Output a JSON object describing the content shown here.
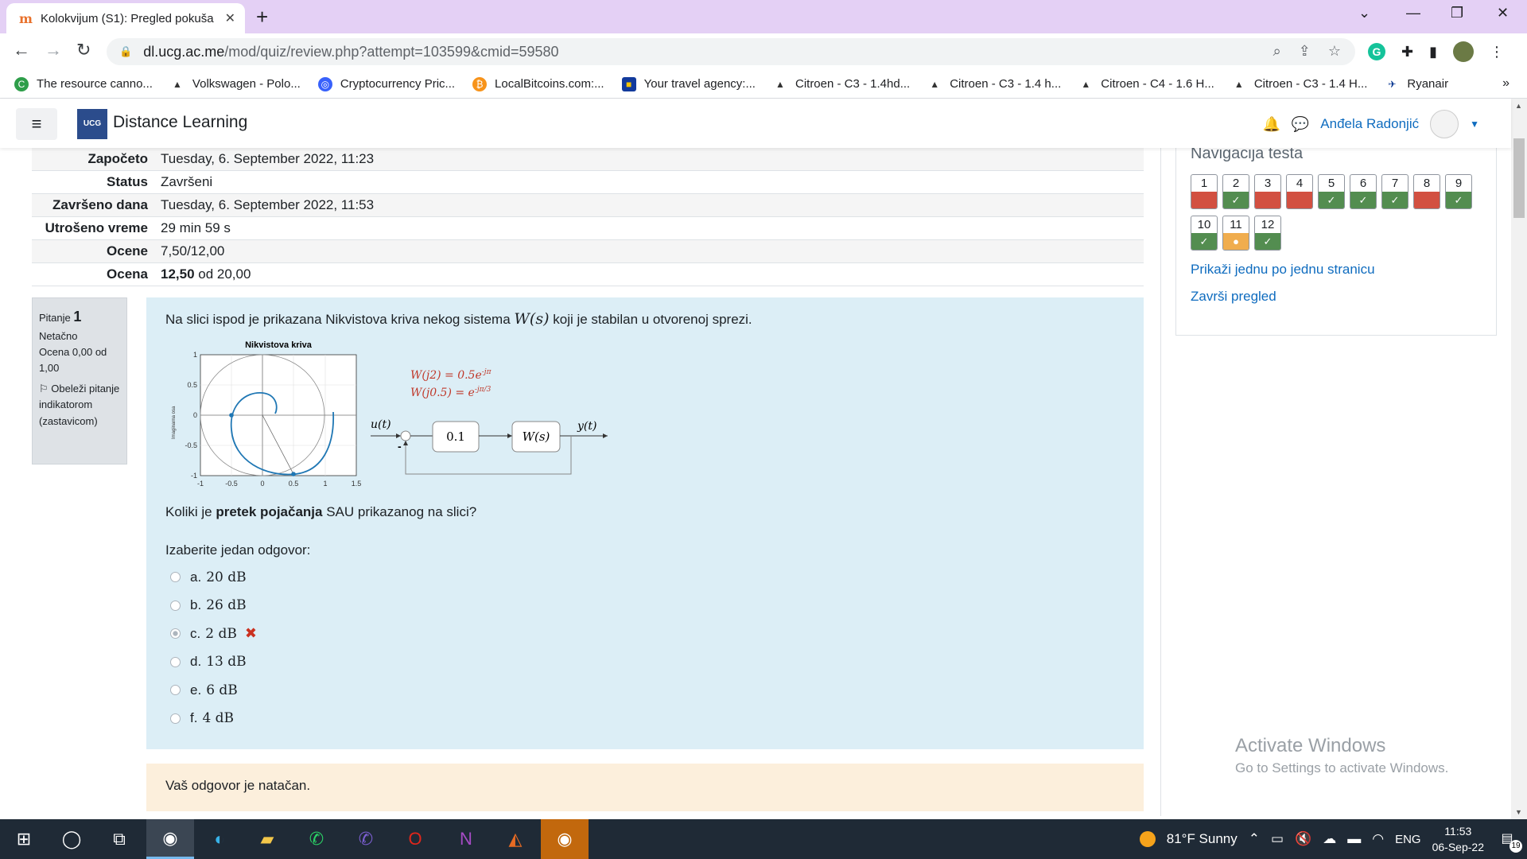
{
  "browser": {
    "tab_title": "Kolokvijum (S1): Pregled pokuša",
    "url_host": "dl.ucg.ac.me",
    "url_path": "/mod/quiz/review.php?attempt=103599&cmid=59580",
    "bookmarks": [
      "The resource canno...",
      "Volkswagen - Polo...",
      "Cryptocurrency Pric...",
      "LocalBitcoins.com:...",
      "Your travel agency:...",
      "Citroen - C3 - 1.4hd...",
      "Citroen - C3 - 1.4 h...",
      "Citroen - C4 - 1.6 H...",
      "Citroen - C3 - 1.4 H...",
      "Ryanair"
    ]
  },
  "header": {
    "site_name": "Distance Learning",
    "logo_text": "UCG",
    "user_name": "Anđela Radonjić"
  },
  "summary": [
    {
      "label": "Započeto",
      "value": "Tuesday, 6. September 2022, 11:23"
    },
    {
      "label": "Status",
      "value": "Završeni"
    },
    {
      "label": "Završeno dana",
      "value": "Tuesday, 6. September 2022, 11:53"
    },
    {
      "label": "Utrošeno vreme",
      "value": "29 min 59 s"
    },
    {
      "label": "Ocene",
      "value": "7,50/12,00"
    },
    {
      "label": "Ocena",
      "value_bold": "12,50",
      "value_rest": " od 20,00"
    }
  ],
  "question_info": {
    "label": "Pitanje",
    "number": "1",
    "state": "Netačno",
    "grade": "Ocena 0,00 od 1,00",
    "flag": "Obeleži pitanje indikatorom (zastavicom)"
  },
  "question": {
    "text_before": "Na slici ispod je prikazana Nikvistova kriva nekog sistema ",
    "math_ws": "W(s)",
    "text_after": " koji je stabilan u otvorenoj sprezi.",
    "figure": {
      "plot_title": "Nikvistova kriva",
      "ylabel": "Imaginarna osa",
      "xticks": [
        "-1",
        "-0.5",
        "0",
        "0.5",
        "1",
        "1.5"
      ],
      "yticks": [
        "1",
        "0.5",
        "0",
        "-0.5",
        "-1"
      ],
      "eq1": "W(j2) = 0.5e",
      "eq1_exp": "-jπ",
      "eq2": "W(j0.5) = e",
      "eq2_exp": "-jπ/3",
      "input_label": "u(t)",
      "output_label": "y(t)",
      "gain_block": "0.1",
      "plant_block": "W(s)",
      "minus_sign": "-"
    },
    "sub_before": "Koliki je ",
    "sub_bold": "pretek pojačanja",
    "sub_after": " SAU prikazanog na slici?",
    "prompt": "Izaberite jedan odgovor:",
    "answers": [
      {
        "letter": "a.",
        "value": "20 dB",
        "checked": false
      },
      {
        "letter": "b.",
        "value": "26 dB",
        "checked": false
      },
      {
        "letter": "c.",
        "value": "2 dB",
        "checked": true
      },
      {
        "letter": "d.",
        "value": "13 dB",
        "checked": false
      },
      {
        "letter": "e.",
        "value": "6 dB",
        "checked": false
      },
      {
        "letter": "f.",
        "value": "4 dB",
        "checked": false
      }
    ],
    "feedback": "Vaš odgovor je natačan."
  },
  "navigation": {
    "title": "Navigacija testa",
    "questions": [
      {
        "n": "1",
        "state": "red"
      },
      {
        "n": "2",
        "state": "green"
      },
      {
        "n": "3",
        "state": "red"
      },
      {
        "n": "4",
        "state": "red"
      },
      {
        "n": "5",
        "state": "green"
      },
      {
        "n": "6",
        "state": "green"
      },
      {
        "n": "7",
        "state": "green"
      },
      {
        "n": "8",
        "state": "red"
      },
      {
        "n": "9",
        "state": "green"
      },
      {
        "n": "10",
        "state": "green"
      },
      {
        "n": "11",
        "state": "orange"
      },
      {
        "n": "12",
        "state": "green"
      }
    ],
    "link_one_page": "Prikaži jednu po jednu stranicu",
    "link_finish": "Završi pregled"
  },
  "watermark": {
    "line1": "Activate Windows",
    "line2": "Go to Settings to activate Windows."
  },
  "taskbar": {
    "weather": "81°F  Sunny",
    "lang": "ENG",
    "time": "11:53",
    "date": "06-Sep-22",
    "notifications": "19"
  }
}
